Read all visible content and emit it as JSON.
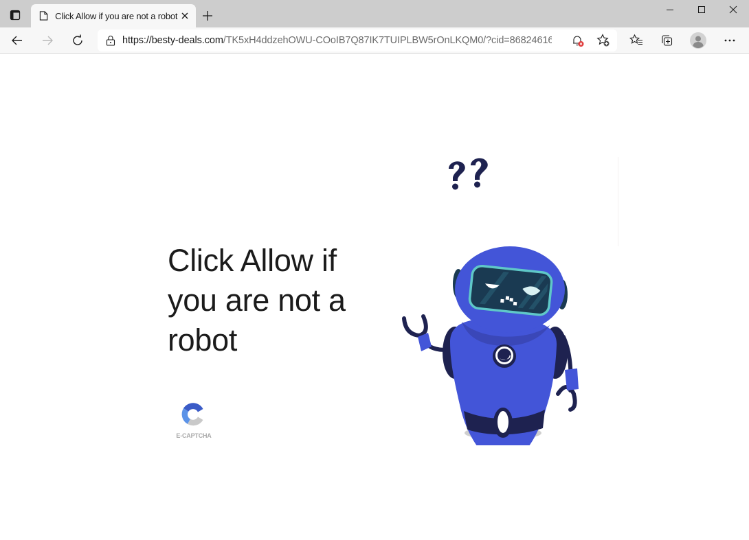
{
  "browser": {
    "tab": {
      "title": "Click Allow if you are not a robot",
      "icon": "page-icon"
    },
    "new_tab_label": "+",
    "window_controls": [
      "minimize",
      "maximize",
      "close"
    ],
    "address_bar": {
      "host": "https://besty-deals.com",
      "path": "/TK5xH4ddzehOWU-COoIB7Q87IK7TUIPLBW5rOnLKQM0/?cid=8682461634...",
      "lock_icon": "lock-icon",
      "notification_icon": "bell-blocked-icon",
      "add_favorite_icon": "star-add-icon"
    },
    "toolbar_icons": [
      "favorites-icon",
      "collections-icon",
      "profile-avatar",
      "more-icon"
    ]
  },
  "page": {
    "headline": "Click Allow if you are not a robot",
    "captcha_brand": "E-CAPTCHA",
    "illustration": "confused-robot",
    "illustration_marks": "??"
  },
  "colors": {
    "robot_body": "#4355d8",
    "robot_dark": "#1e2250",
    "visor": "#1a3a52",
    "visor_rim": "#5fc8c8",
    "captcha_blue_dark": "#3a5bc7",
    "captcha_blue_light": "#5b93e8",
    "captcha_gray": "#c9c9c9",
    "shadow": "#cfcfcf"
  }
}
